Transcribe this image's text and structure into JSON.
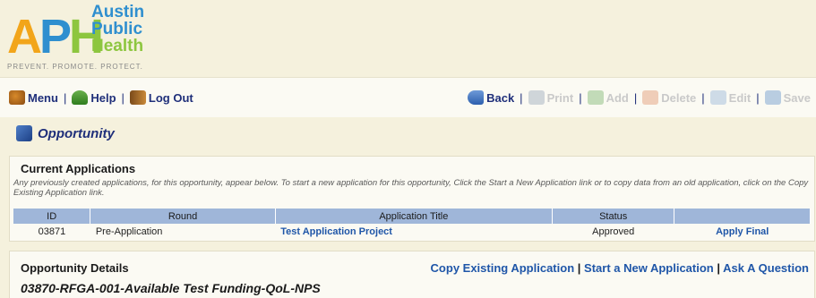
{
  "logo": {
    "letters_a": "A",
    "letters_p": "P",
    "letters_h": "H",
    "word1": "Austin",
    "word2": "Public",
    "word3": "Health",
    "tagline": "PREVENT. PROMOTE. PROTECT."
  },
  "toolbar": {
    "left": [
      {
        "label": "Menu",
        "icon": "menu-icon"
      },
      {
        "label": "Help",
        "icon": "help-icon"
      },
      {
        "label": "Log Out",
        "icon": "logout-icon"
      }
    ],
    "right": [
      {
        "label": "Back",
        "icon": "back-icon",
        "enabled": true
      },
      {
        "label": "Print",
        "icon": "print-icon",
        "enabled": false
      },
      {
        "label": "Add",
        "icon": "add-icon",
        "enabled": false
      },
      {
        "label": "Delete",
        "icon": "delete-icon",
        "enabled": false
      },
      {
        "label": "Edit",
        "icon": "edit-icon",
        "enabled": false
      },
      {
        "label": "Save",
        "icon": "save-icon",
        "enabled": false
      }
    ],
    "separator": "|"
  },
  "page": {
    "title": "Opportunity",
    "title_icon": "opportunity-icon"
  },
  "current_applications": {
    "title": "Current Applications",
    "note": "Any previously created applications, for this opportunity, appear below. To start a new application for this opportunity, Click the Start a New Application link or to copy data from an old application, click on the Copy Existing Application link.",
    "columns": [
      "ID",
      "Round",
      "Application Title",
      "Status",
      ""
    ],
    "rows": [
      {
        "id": "03871",
        "round": "Pre-Application",
        "title": "Test Application Project",
        "status": "Approved",
        "action": "Apply Final"
      }
    ]
  },
  "opportunity_details": {
    "title": "Opportunity Details",
    "links": [
      "Copy Existing Application",
      "Start a New Application",
      "Ask A Question"
    ],
    "separator": "|",
    "name": "03870-RFGA-001-Available Test Funding-QoL-NPS"
  },
  "colors": {
    "background": "#f5f1dd",
    "accent_blue": "#1f56a8",
    "table_header": "#9fb6d9",
    "logo_orange": "#f2a51a",
    "logo_blue": "#2f8fcf",
    "logo_green": "#8dc63f"
  }
}
